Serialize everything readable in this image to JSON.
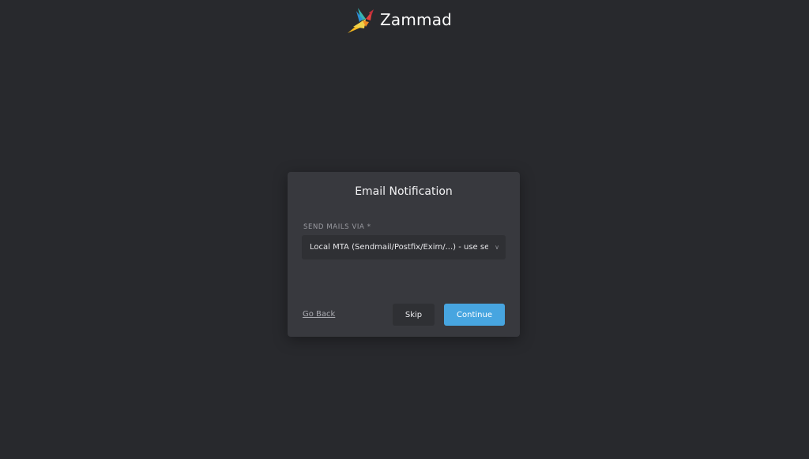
{
  "logo": {
    "text": "Zammad"
  },
  "dialog": {
    "title": "Email Notification",
    "field_label": "SEND MAILS VIA *",
    "select_value": "Local MTA (Sendmail/Postfix/Exim/...) - use server setup",
    "go_back_label": "Go Back",
    "skip_label": "Skip",
    "continue_label": "Continue"
  },
  "colors": {
    "background": "#28292d",
    "dialog": "#38393e",
    "accent": "#47a5e0"
  },
  "icons": {
    "logo": "zammad-bird-icon",
    "select_chevron": "chevron-down-icon"
  }
}
